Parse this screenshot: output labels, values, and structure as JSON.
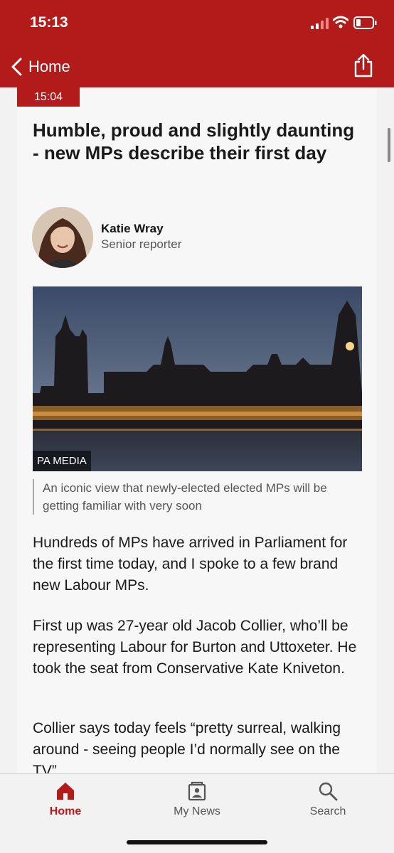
{
  "status_bar": {
    "time": "15:13"
  },
  "header": {
    "back_label": "Home"
  },
  "post": {
    "time": "15:04",
    "headline": "Humble, proud and slightly daunting - new MPs describe their first day",
    "author": {
      "name": "Katie Wray",
      "role": "Senior reporter"
    },
    "image": {
      "credit": "PA MEDIA",
      "caption": "An iconic view that newly-elected elected MPs will be getting familiar with very soon"
    },
    "paragraphs": [
      "Hundreds of MPs have arrived in Parliament for the first time today, and I spoke to a few brand new Labour MPs.",
      "First up was 27-year old Jacob Collier, who’ll be representing Labour for Burton and Uttoxeter. He took the seat from Conservative Kate Kniveton.",
      "Collier says today feels “pretty surreal, walking around - seeing people I’d normally see on the TV”."
    ]
  },
  "bottom_nav": [
    {
      "label": "Home",
      "icon": "home-icon",
      "active": true
    },
    {
      "label": "My News",
      "icon": "my-news-icon",
      "active": false
    },
    {
      "label": "Search",
      "icon": "search-icon",
      "active": false
    }
  ],
  "colors": {
    "brand": "#b31b1b",
    "background": "#f2f2f2",
    "text": "#1a1a1a"
  }
}
